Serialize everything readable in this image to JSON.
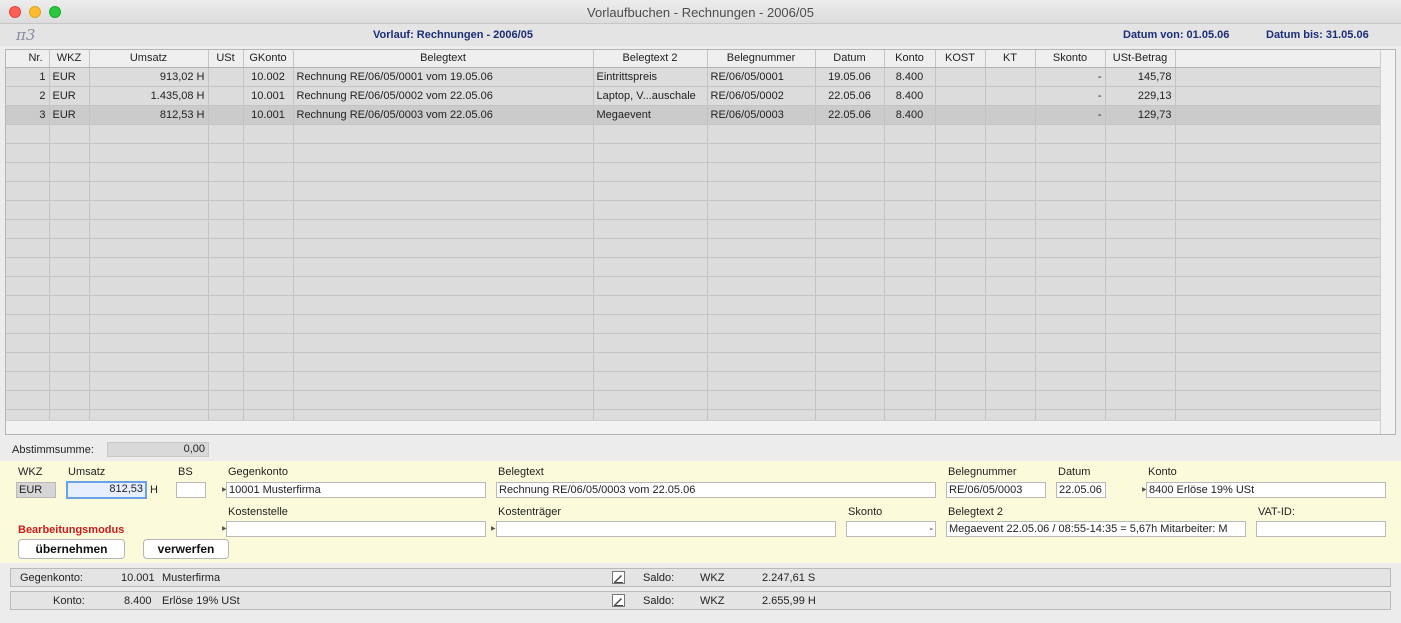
{
  "window": {
    "title": "Vorlaufbuchen - Rechnungen - 2006/05"
  },
  "header": {
    "logo": "π3",
    "vorlauf": "Vorlauf: Rechnungen - 2006/05",
    "datum_von": "Datum von: 01.05.06",
    "datum_bis": "Datum bis: 31.05.06"
  },
  "table": {
    "columns": [
      "Nr.",
      "WKZ",
      "Umsatz",
      "USt",
      "GKonto",
      "Belegtext",
      "Belegtext 2",
      "Belegnummer",
      "Datum",
      "Konto",
      "KOST",
      "KT",
      "Skonto",
      "USt-Betrag"
    ],
    "rows": [
      {
        "nr": "1",
        "wkz": "EUR",
        "umsatz": "913,02 H",
        "ust": "",
        "gkonto": "10.002",
        "belegtext": "Rechnung RE/06/05/0001 vom 19.05.06",
        "belegtext2": "Eintrittspreis",
        "belegnummer": "RE/06/05/0001",
        "datum": "19.05.06",
        "konto": "8.400",
        "kost": "",
        "kt": "",
        "skonto": "-",
        "ust_betrag": "145,78"
      },
      {
        "nr": "2",
        "wkz": "EUR",
        "umsatz": "1.435,08 H",
        "ust": "",
        "gkonto": "10.001",
        "belegtext": "Rechnung RE/06/05/0002 vom 22.05.06",
        "belegtext2": "Laptop, V...auschale",
        "belegnummer": "RE/06/05/0002",
        "datum": "22.05.06",
        "konto": "8.400",
        "kost": "",
        "kt": "",
        "skonto": "-",
        "ust_betrag": "229,13"
      },
      {
        "nr": "3",
        "wkz": "EUR",
        "umsatz": "812,53 H",
        "ust": "",
        "gkonto": "10.001",
        "belegtext": "Rechnung RE/06/05/0003 vom 22.05.06",
        "belegtext2": "Megaevent",
        "belegnummer": "RE/06/05/0003",
        "datum": "22.05.06",
        "konto": "8.400",
        "kost": "",
        "kt": "",
        "skonto": "-",
        "ust_betrag": "129,73"
      }
    ],
    "selected_row": 2
  },
  "abstimmsumme": {
    "label": "Abstimmsumme:",
    "value": "0,00"
  },
  "edit": {
    "labels": {
      "wkz": "WKZ",
      "umsatz": "Umsatz",
      "bs": "BS",
      "gegenkonto": "Gegenkonto",
      "belegtext": "Belegtext",
      "belegnummer": "Belegnummer",
      "datum": "Datum",
      "konto": "Konto",
      "kostenstelle": "Kostenstelle",
      "kostentraeger": "Kostenträger",
      "skonto": "Skonto",
      "belegtext2": "Belegtext 2",
      "vat_id": "VAT-ID:"
    },
    "values": {
      "wkz": "EUR",
      "umsatz": "812,53",
      "sh": "H",
      "bs": "",
      "gegenkonto": "10001 Musterfirma",
      "belegtext": "Rechnung RE/06/05/0003 vom 22.05.06",
      "belegnummer": "RE/06/05/0003",
      "datum": "22.05.06",
      "konto": "8400 Erlöse 19% USt",
      "kostenstelle": "",
      "kostentraeger": "",
      "skonto": "-",
      "belegtext2": "Megaevent 22.05.06 / 08:55-14:35 = 5,67h Mitarbeiter: M",
      "vat_id": ""
    },
    "modus": "Bearbeitungsmodus",
    "buttons": {
      "uebernehmen": "übernehmen",
      "verwerfen": "verwerfen"
    }
  },
  "saldo": [
    {
      "label": "Gegenkonto:",
      "number": "10.001",
      "name": "Musterfirma",
      "saldo_label": "Saldo:",
      "wkz": "WKZ",
      "amount": "2.247,61 S"
    },
    {
      "label": "Konto:",
      "number": "8.400",
      "name": "Erlöse 19% USt",
      "saldo_label": "Saldo:",
      "wkz": "WKZ",
      "amount": "2.655,99 H"
    }
  ],
  "colors": {
    "accent": "#1c2e78",
    "modus": "#cc1b1b",
    "panel": "#fbfbdc"
  }
}
